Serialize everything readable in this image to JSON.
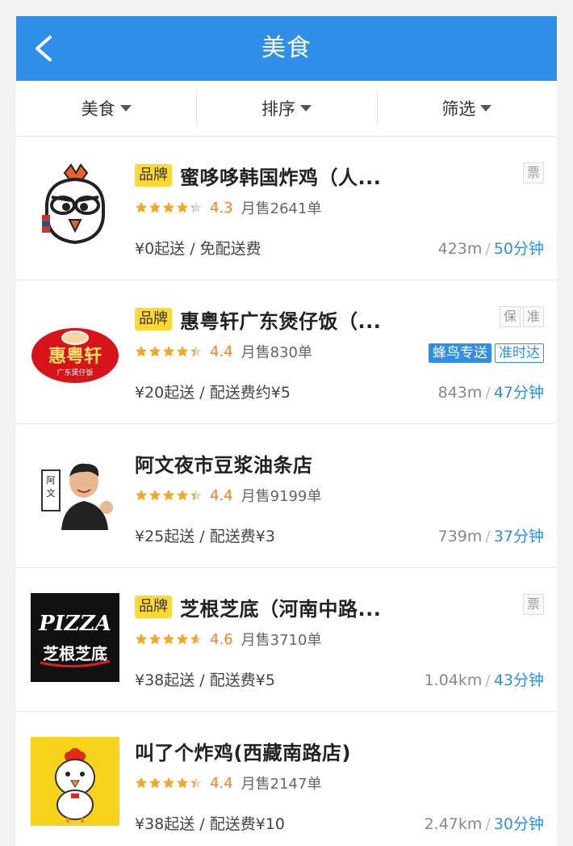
{
  "header": {
    "title": "美食"
  },
  "filters": [
    {
      "label": "美食"
    },
    {
      "label": "排序"
    },
    {
      "label": "筛选"
    }
  ],
  "colors": {
    "primary": "#2f8ee8",
    "brand_tag": "#ffd930",
    "rating": "#ff7d1f",
    "star": "#f5a623"
  },
  "shops": [
    {
      "brand": "品牌",
      "name": "蜜哆哆韩国炸鸡（人...",
      "tags": [
        "票"
      ],
      "rating": "4.3",
      "stars": 4.3,
      "sales": "月售2641单",
      "delivery_tags": [],
      "price": "¥0起送 / 免配送费",
      "distance": "423m",
      "sep": "/",
      "time": "50分钟",
      "logo": "chicken-cartoon-logo"
    },
    {
      "brand": "品牌",
      "name": "惠粤轩广东煲仔饭（...",
      "tags": [
        "保",
        "准"
      ],
      "rating": "4.4",
      "stars": 4.4,
      "sales": "月售830单",
      "delivery_tags": [
        "蜂鸟专送",
        "准时达"
      ],
      "price": "¥20起送 / 配送费约¥5",
      "distance": "843m",
      "sep": "/",
      "time": "47分钟",
      "logo": "huiyuexuan-logo",
      "logo_text": "惠粤轩",
      "logo_sub": "广东煲仔饭"
    },
    {
      "brand": "",
      "name": "阿文夜市豆浆油条店",
      "tags": [],
      "rating": "4.4",
      "stars": 4.4,
      "sales": "月售9199单",
      "delivery_tags": [],
      "price": "¥25起送 / 配送费¥3",
      "distance": "739m",
      "sep": "/",
      "time": "37分钟",
      "logo": "awen-portrait-logo",
      "logo_text": "阿文"
    },
    {
      "brand": "品牌",
      "name": "芝根芝底（河南中路...",
      "tags": [
        "票"
      ],
      "rating": "4.6",
      "stars": 4.6,
      "sales": "月售3710单",
      "delivery_tags": [],
      "price": "¥38起送 / 配送费¥5",
      "distance": "1.04km",
      "sep": "/",
      "time": "43分钟",
      "logo": "pizza-logo",
      "logo_text": "PIZZA",
      "logo_sub": "芝根芝底"
    },
    {
      "brand": "",
      "name": "叫了个炸鸡(西藏南路店)",
      "tags": [],
      "rating": "4.4",
      "stars": 4.4,
      "sales": "月售2147单",
      "delivery_tags": [],
      "price": "¥38起送 / 配送费¥10",
      "distance": "2.47km",
      "sep": "/",
      "time": "30分钟",
      "logo": "chick-mascot-logo"
    }
  ]
}
